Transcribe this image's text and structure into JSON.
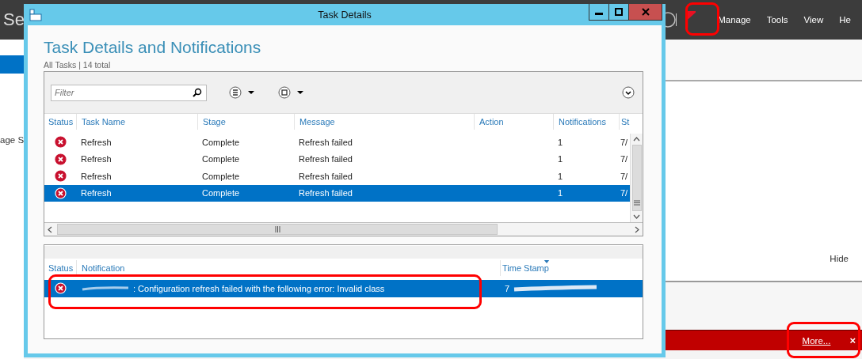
{
  "background_app": {
    "title": "Se",
    "menu": [
      "Manage",
      "Tools",
      "View",
      "He"
    ],
    "sidebar_item": "age S",
    "hide_link": "Hide",
    "notification_bar": {
      "link": "More...",
      "close": "×"
    }
  },
  "window": {
    "title": "Task Details"
  },
  "heading": "Task Details and Notifications",
  "subtitle": "All Tasks | 14 total",
  "filter": {
    "placeholder": "Filter"
  },
  "tasks": {
    "columns": [
      "Status",
      "Task Name",
      "Stage",
      "Message",
      "Action",
      "Notifications",
      "St"
    ],
    "rows": [
      {
        "failed": true,
        "task_name": "Refresh",
        "stage": "Complete",
        "message": "Refresh failed",
        "notifications": "1",
        "column_7": "7/",
        "selected": false
      },
      {
        "failed": true,
        "task_name": "Refresh",
        "stage": "Complete",
        "message": "Refresh failed",
        "notifications": "1",
        "column_7": "7/",
        "selected": false
      },
      {
        "failed": true,
        "task_name": "Refresh",
        "stage": "Complete",
        "message": "Refresh failed",
        "notifications": "1",
        "column_7": "7/",
        "selected": false
      },
      {
        "failed": true,
        "task_name": "Refresh",
        "stage": "Complete",
        "message": "Refresh failed",
        "notifications": "1",
        "column_7": "7/",
        "selected": true
      }
    ]
  },
  "notifications": {
    "columns": [
      "Status",
      "Notification",
      "Time Stamp"
    ],
    "rows": [
      {
        "failed": true,
        "notification": ": Configuration refresh failed with the following error: Invalid class",
        "time_stamp": "7",
        "selected": true
      }
    ]
  }
}
